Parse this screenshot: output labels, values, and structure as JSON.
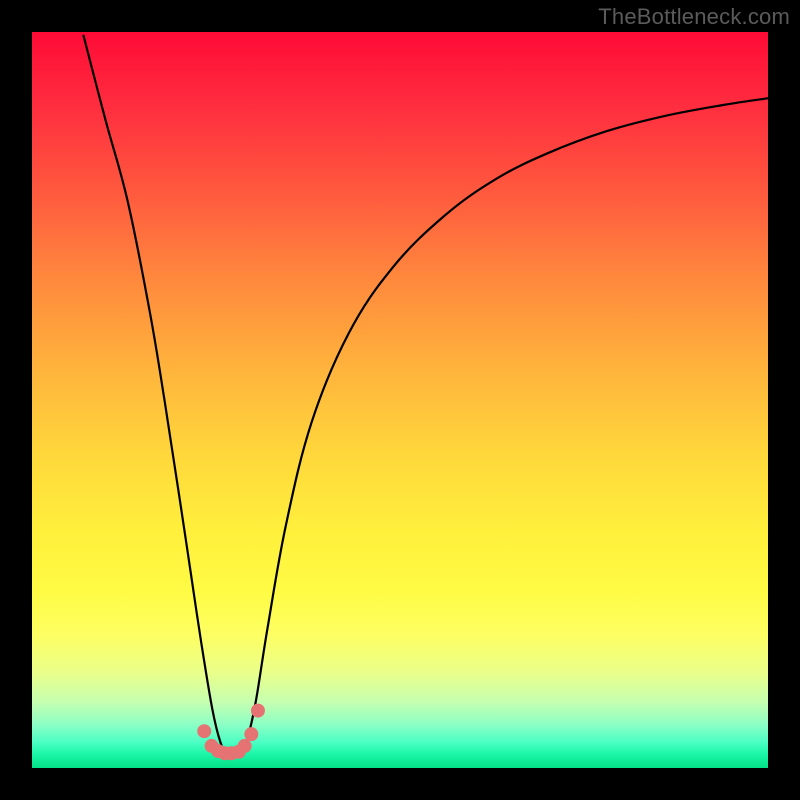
{
  "watermark": {
    "text": "TheBottleneck.com"
  },
  "gradient": {
    "top_color": "#ff0b36",
    "bottom_color": "#04e188",
    "description": "vertical red-to-green gradient"
  },
  "chart_data": {
    "type": "line",
    "title": "",
    "xlabel": "",
    "ylabel": "",
    "xlim": [
      0,
      100
    ],
    "ylim": [
      0,
      100
    ],
    "grid": false,
    "legend": false,
    "annotations": [],
    "series": [
      {
        "name": "black-curve",
        "color": "#000000",
        "x": [
          7,
          10,
          13,
          16,
          18,
          20,
          21.5,
          23,
          24.5,
          25.6,
          26.4,
          27.2,
          28.2,
          29.2,
          30.4,
          32,
          34.5,
          38,
          43,
          49,
          56,
          63,
          70,
          78,
          86,
          94,
          100
        ],
        "y": [
          99.5,
          88,
          77,
          62,
          50,
          37,
          27,
          17,
          8,
          3.5,
          2.2,
          2.0,
          2.2,
          3.8,
          9,
          19,
          33,
          47,
          59,
          68,
          75,
          80,
          83.5,
          86.5,
          88.6,
          90.1,
          91
        ]
      },
      {
        "name": "marker-dots",
        "type": "scatter",
        "color": "#e57373",
        "x": [
          23.4,
          24.4,
          25.3,
          26.2,
          27.1,
          28.1,
          28.9,
          29.8,
          30.7
        ],
        "y": [
          5.0,
          3.0,
          2.3,
          2.0,
          2.0,
          2.2,
          3.0,
          4.6,
          7.8
        ]
      }
    ]
  }
}
